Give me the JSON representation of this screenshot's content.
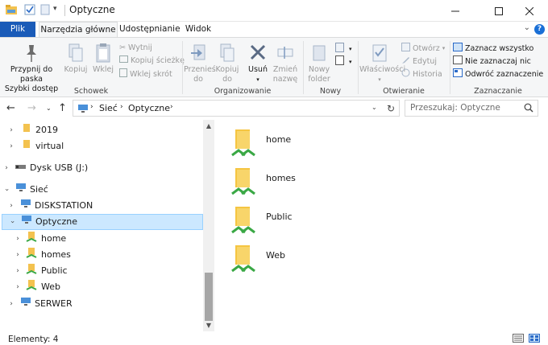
{
  "window": {
    "title": "Optyczne",
    "minimize_icon": "minimize-icon",
    "maximize_icon": "maximize-icon",
    "close_icon": "close-icon"
  },
  "tabs": [
    {
      "label": "Plik"
    },
    {
      "label": "Narzędzia główne"
    },
    {
      "label": "Udostępnianie"
    },
    {
      "label": "Widok"
    }
  ],
  "ribbon": {
    "schowek": {
      "group_label": "Schowek",
      "pin_label_1": "Przypnij do paska",
      "pin_label_2": "Szybki dostęp",
      "copy_label": "Kopiuj",
      "paste_label": "Wklej",
      "cut_label": "Wytnij",
      "copy_path_label": "Kopiuj ścieżkę",
      "paste_shortcut_label": "Wklej skrót"
    },
    "organizowanie": {
      "group_label": "Organizowanie",
      "move_label_1": "Przenieś",
      "move_label_2": "do",
      "copy_to_label_1": "Kopiuj",
      "copy_to_label_2": "do",
      "delete_label": "Usuń",
      "rename_label_1": "Zmień",
      "rename_label_2": "nazwę"
    },
    "nowy": {
      "group_label": "Nowy",
      "new_folder_label_1": "Nowy",
      "new_folder_label_2": "folder"
    },
    "otwieranie": {
      "group_label": "Otwieranie",
      "properties_label": "Właściwości",
      "open_label": "Otwórz",
      "edit_label": "Edytuj",
      "history_label": "Historia"
    },
    "zaznaczanie": {
      "group_label": "Zaznaczanie",
      "select_all_label": "Zaznacz wszystko",
      "select_none_label": "Nie zaznaczaj nic",
      "invert_label": "Odwróć zaznaczenie"
    }
  },
  "address": {
    "segments": [
      "Sieć",
      "Optyczne"
    ],
    "separator": "›",
    "search_placeholder": "Przeszukaj: Optyczne"
  },
  "nav_tree": [
    {
      "label": "2019"
    },
    {
      "label": "virtual"
    },
    {
      "label": "Dysk USB (J:)"
    },
    {
      "label": "Sieć"
    },
    {
      "label": "DISKSTATION"
    },
    {
      "label": "Optyczne"
    },
    {
      "label": "home"
    },
    {
      "label": "homes"
    },
    {
      "label": "Public"
    },
    {
      "label": "Web"
    },
    {
      "label": "SERWER"
    }
  ],
  "content_items": [
    {
      "label": "home"
    },
    {
      "label": "homes"
    },
    {
      "label": "Public"
    },
    {
      "label": "Web"
    }
  ],
  "status": {
    "text": "Elementy: 4"
  },
  "colors": {
    "accent": "#1a5bb8",
    "selection": "#cce8ff",
    "folder": "#f5c542",
    "share": "#3aa845"
  }
}
